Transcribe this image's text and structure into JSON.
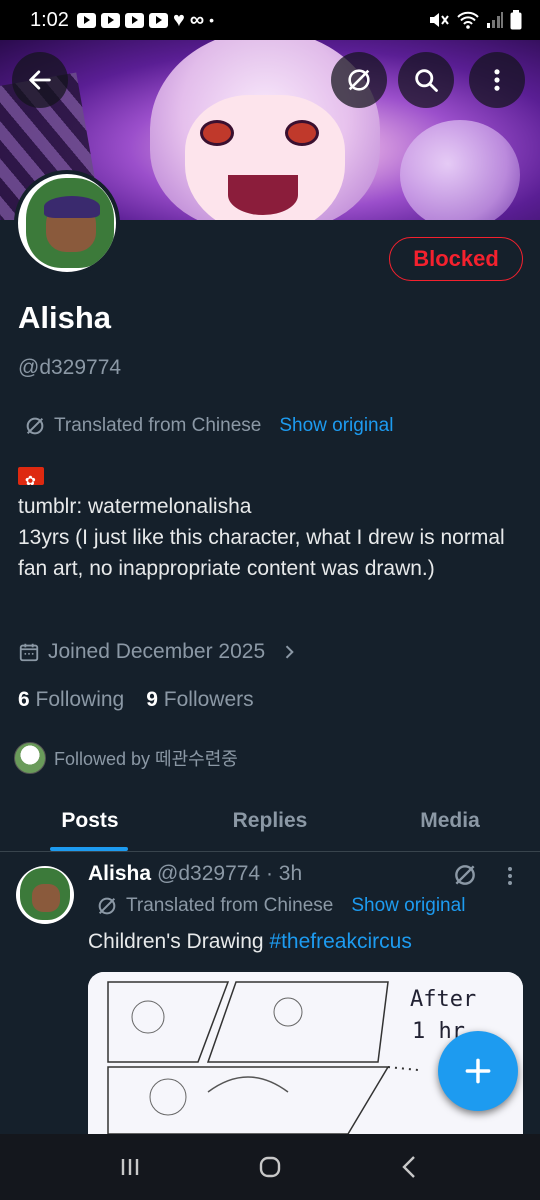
{
  "status_bar": {
    "time": "1:02"
  },
  "profile": {
    "name": "Alisha",
    "handle": "@d329774",
    "blocked_label": "Blocked",
    "translated_label": "Translated from Chinese",
    "show_original": "Show original",
    "bio_lines": [
      "tumblr: watermelonalisha",
      "13yrs (I just like this character, what I drew is normal fan art, no inappropriate content was drawn.)"
    ],
    "joined": "Joined December 2025",
    "following_count": "6",
    "following_label": "Following",
    "followers_count": "9",
    "followers_label": "Followers",
    "followed_by": "Followed by 떼관수련중"
  },
  "tabs": [
    {
      "label": "Posts",
      "active": true
    },
    {
      "label": "Replies",
      "active": false
    },
    {
      "label": "Media",
      "active": false
    }
  ],
  "post": {
    "author": "Alisha",
    "handle_time": "@d329774 · 3h",
    "translated_label": "Translated from Chinese",
    "show_original": "Show original",
    "text": "Children's Drawing ",
    "hashtag": "#thefreakcircus",
    "image_text": "After 1 hr"
  },
  "colors": {
    "accent": "#1d9bf0",
    "blocked": "#f4212e",
    "background": "#15202b"
  },
  "icons": [
    "back-arrow-icon",
    "translate-icon",
    "search-icon",
    "more-vertical-icon",
    "calendar-icon",
    "chevron-right-icon",
    "plus-icon",
    "recents-icon",
    "home-icon",
    "nav-back-icon"
  ]
}
